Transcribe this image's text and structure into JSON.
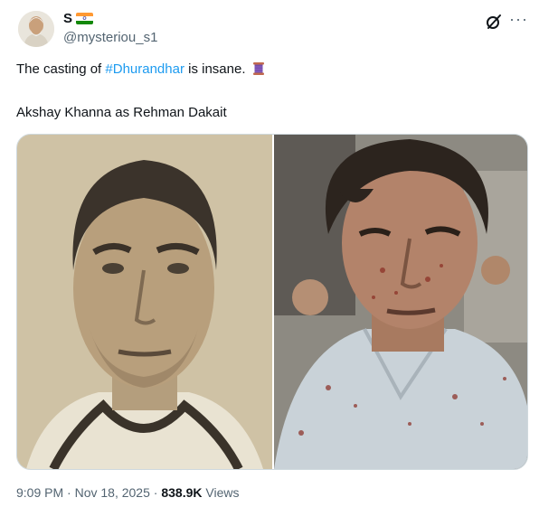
{
  "author": {
    "display_name": "S",
    "handle": "@mysteriou_s1",
    "flag_colors": [
      "#ff9933",
      "#ffffff",
      "#138808"
    ]
  },
  "header": {
    "grok_icon": "grok-slash-icon",
    "more_icon": "more-horizontal-icon",
    "more_text": "···"
  },
  "tweet": {
    "text_before": "The casting of ",
    "hashtag": "#Dhurandhar",
    "text_after": " is insane.",
    "emoji": "spool-of-thread",
    "line2": "Akshay Khanna as Rehman Dakait"
  },
  "meta": {
    "time": "9:09 PM",
    "separator1": " · ",
    "date": "Nov 18, 2025",
    "separator2": " · ",
    "views_count": "838.9K",
    "views_label": " Views"
  },
  "colors": {
    "accent": "#1d9bf0",
    "secondary_text": "#536471",
    "primary_text": "#0f1419"
  }
}
